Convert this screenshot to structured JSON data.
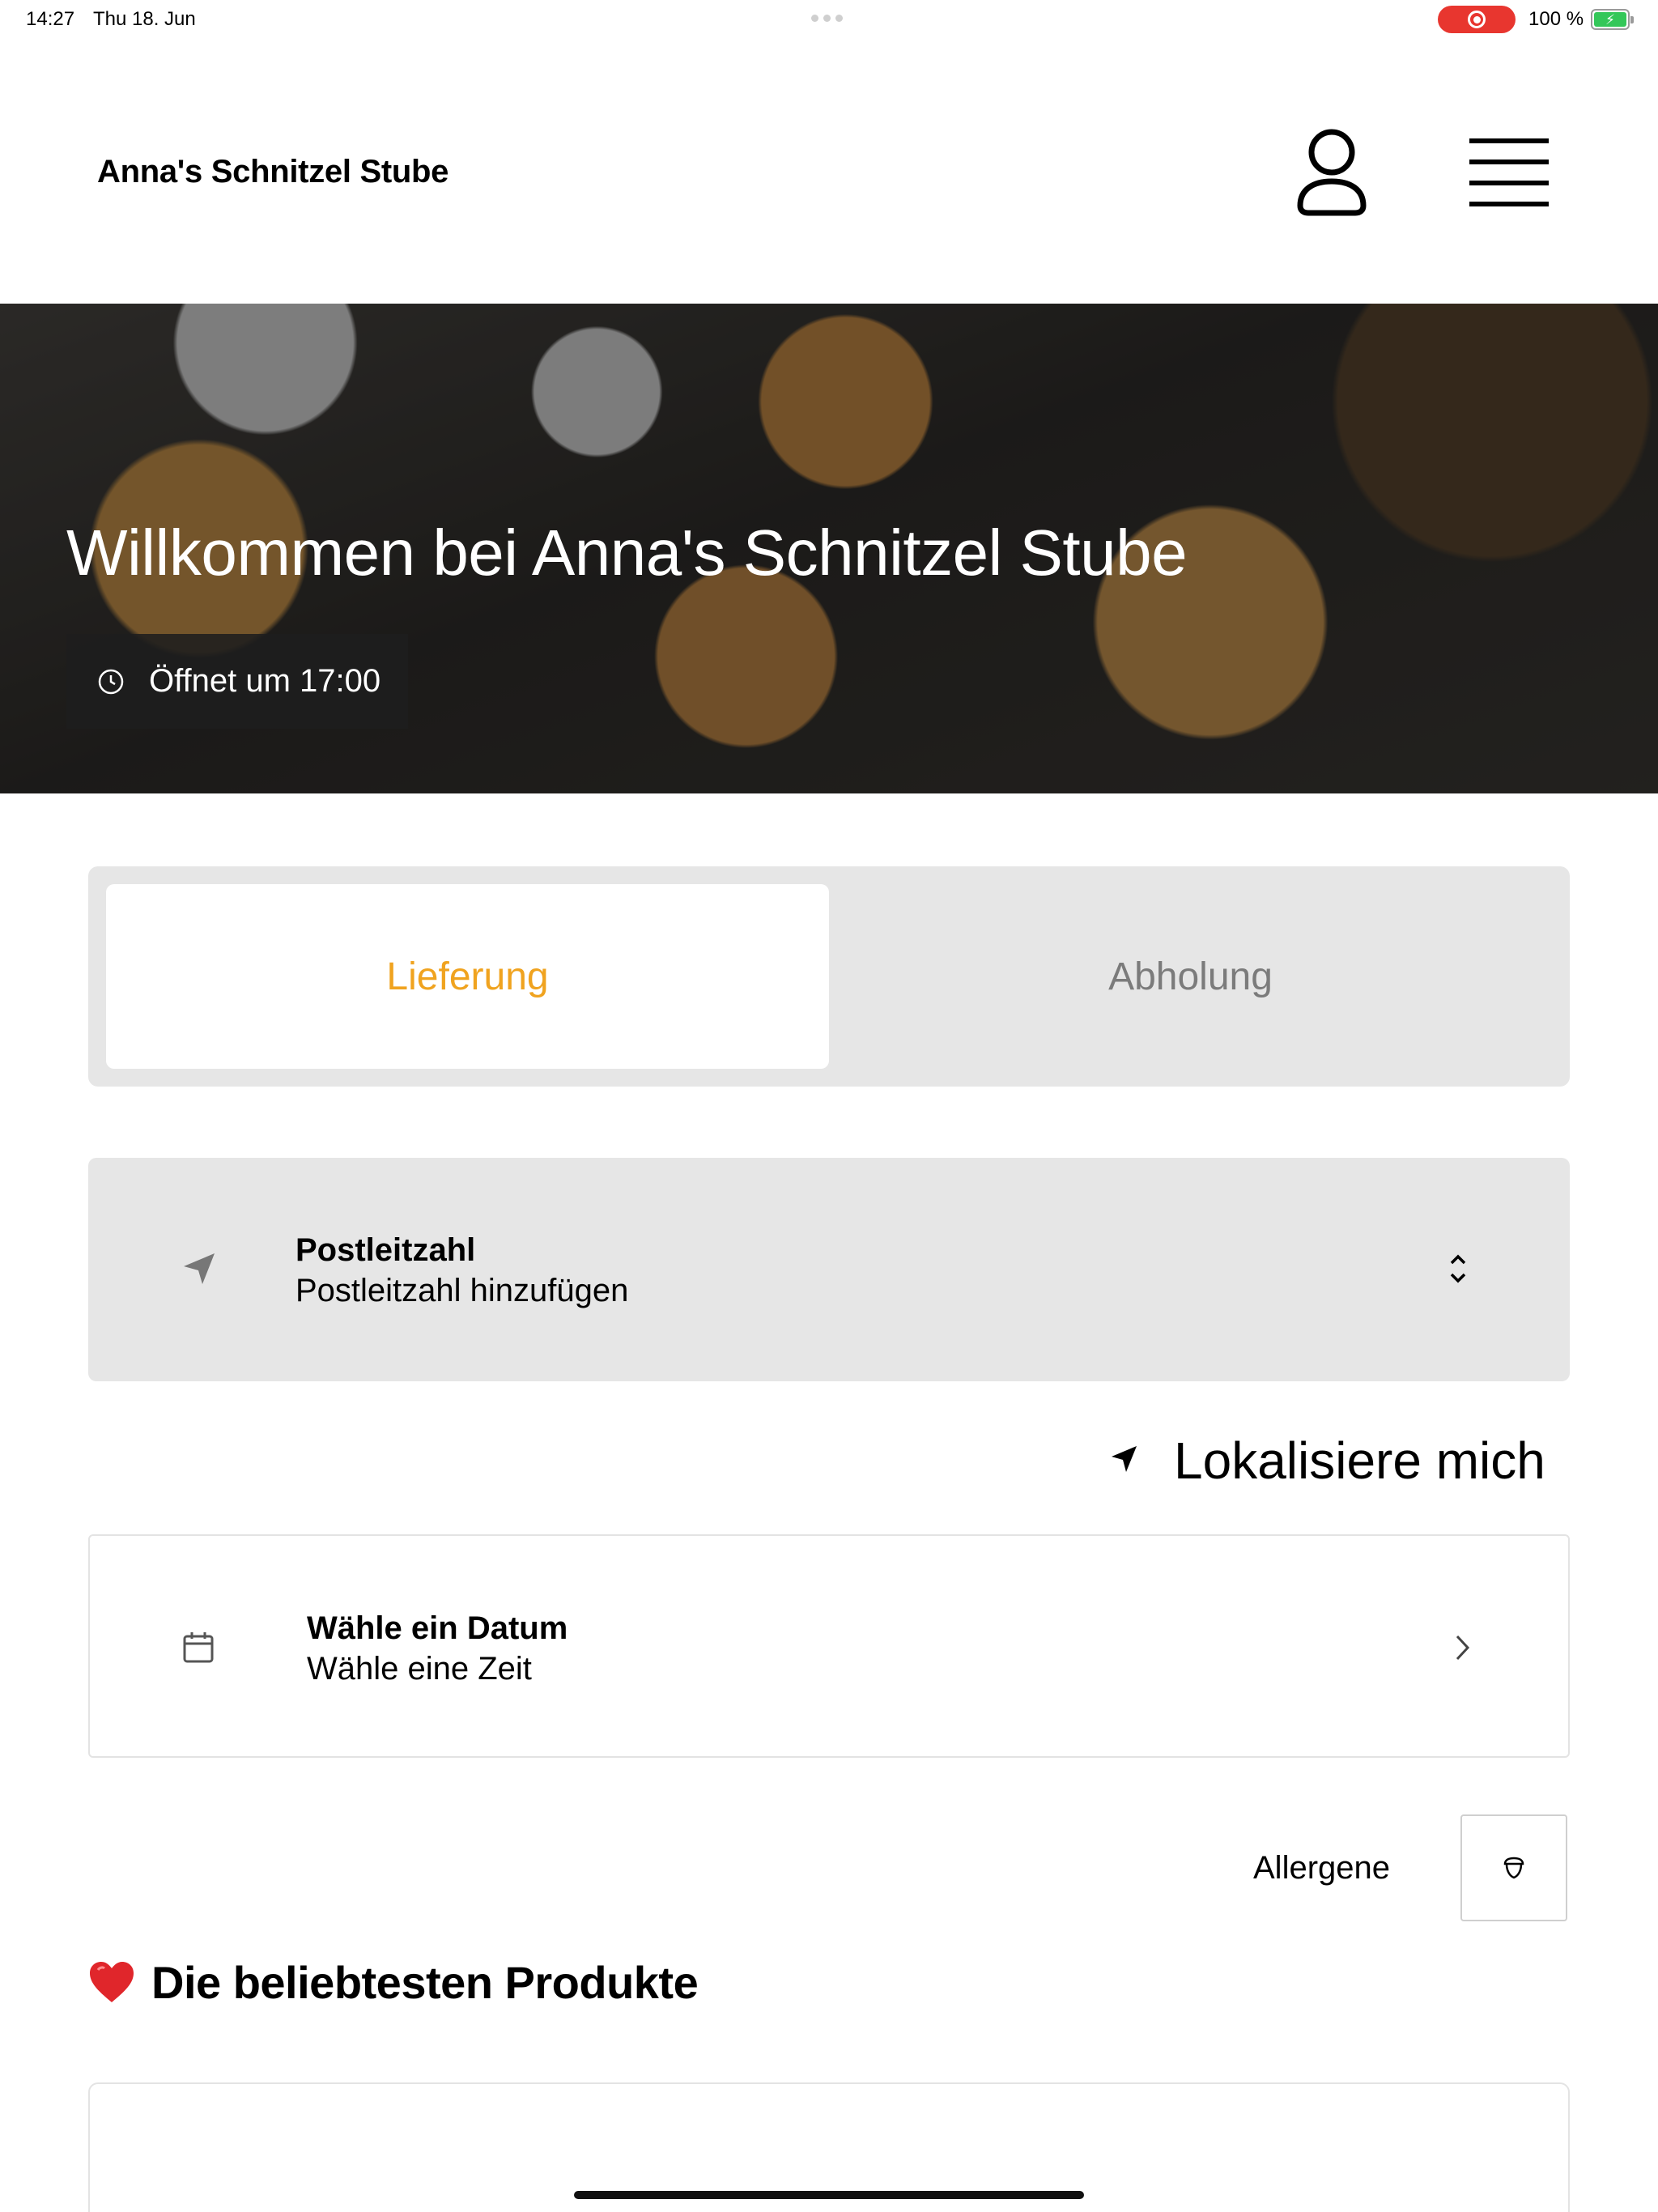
{
  "status_bar": {
    "time": "14:27",
    "date": "Thu 18. Jun",
    "battery_percent": "100 %",
    "battery_level": 1.0,
    "recording_color": "#e8362f",
    "battery_color": "#34c759"
  },
  "header": {
    "brand": "Anna's Schnitzel Stube",
    "account_icon": "user-icon",
    "menu_icon": "hamburger-menu-icon"
  },
  "hero": {
    "title": "Willkommen bei Anna's Schnitzel Stube",
    "hours_text": "Öffnet um 17:00",
    "hours_icon": "clock-icon"
  },
  "order_mode": {
    "options": [
      "Lieferung",
      "Abholung"
    ],
    "selected": "Lieferung",
    "accent_color": "#f0a31f"
  },
  "postcode": {
    "label": "Postleitzahl",
    "value": "Postleitzahl hinzufügen",
    "icon": "location-arrow-icon"
  },
  "locate": {
    "label": "Lokalisiere mich",
    "icon": "location-arrow-icon"
  },
  "schedule": {
    "label": "Wähle ein Datum",
    "value": "Wähle eine Zeit",
    "icon": "calendar-icon"
  },
  "allergens": {
    "label": "Allergene",
    "icon": "acorn-icon"
  },
  "popular": {
    "title": "Die beliebtesten Produkte",
    "icon": "heart-icon"
  }
}
